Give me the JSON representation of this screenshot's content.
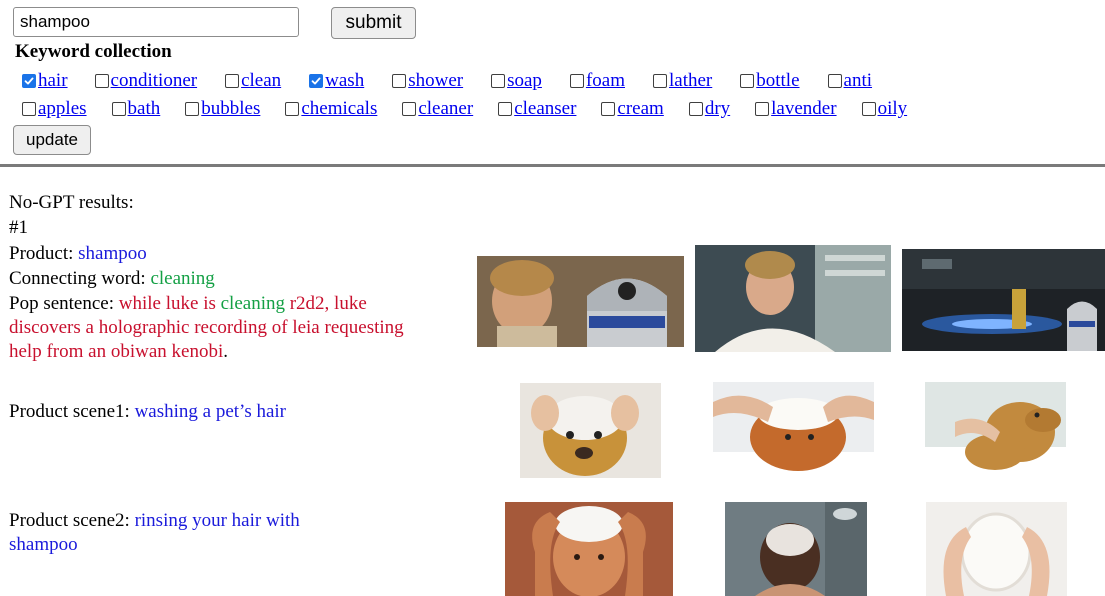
{
  "search": {
    "value": "shampoo",
    "submit_label": "submit"
  },
  "keyword_collection": {
    "title": "Keyword collection",
    "row1": [
      {
        "label": "hair",
        "checked": true
      },
      {
        "label": "conditioner",
        "checked": false
      },
      {
        "label": "clean",
        "checked": false
      },
      {
        "label": "wash",
        "checked": true
      },
      {
        "label": "shower",
        "checked": false
      },
      {
        "label": "soap",
        "checked": false
      },
      {
        "label": "foam",
        "checked": false
      },
      {
        "label": "lather",
        "checked": false
      },
      {
        "label": "bottle",
        "checked": false
      },
      {
        "label": "anti",
        "checked": false
      }
    ],
    "row2": [
      {
        "label": "apples",
        "checked": false
      },
      {
        "label": "bath",
        "checked": false
      },
      {
        "label": "bubbles",
        "checked": false
      },
      {
        "label": "chemicals",
        "checked": false
      },
      {
        "label": "cleaner",
        "checked": false
      },
      {
        "label": "cleanser",
        "checked": false
      },
      {
        "label": "cream",
        "checked": false
      },
      {
        "label": "dry",
        "checked": false
      },
      {
        "label": "lavender",
        "checked": false
      },
      {
        "label": "oily",
        "checked": false
      }
    ],
    "update_label": "update"
  },
  "results": {
    "heading": "No-GPT results:",
    "number": "#1",
    "product_label": "Product: ",
    "product_value": "shampoo",
    "connecting_label": "Connecting word: ",
    "connecting_value": "cleaning",
    "pop_label": "Pop sentence: ",
    "pop_part1": "while luke is ",
    "pop_word": "cleaning",
    "pop_part2": " r2d2, luke discovers a holographic recording of leia requesting help from an obiwan kenobi",
    "pop_end": ".",
    "scene1_label": "Product scene1: ",
    "scene1_value": "washing a pet’s hair",
    "scene2_label": "Product scene2: ",
    "scene2_value": "rinsing your hair with shampoo"
  },
  "colors": {
    "link": "#0000ee",
    "product_blue": "#1a1adb",
    "connecting_green": "#14a045",
    "pop_red": "#c8102e",
    "checkbox_checked": "#1a73e8"
  }
}
